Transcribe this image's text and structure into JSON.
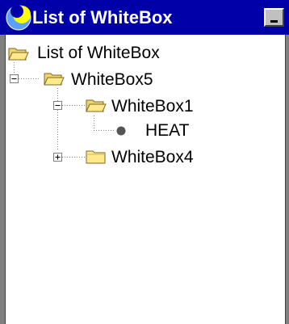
{
  "window": {
    "title": "List of WhiteBox",
    "minimize_icon": "minimize-icon",
    "app_icon": "moon-icon"
  },
  "tree": {
    "root": {
      "label": "List of WhiteBox",
      "icon": "folder-open-icon"
    },
    "nodes": [
      {
        "label": "WhiteBox5",
        "icon": "folder-open-icon",
        "expanded": true
      },
      {
        "label": "WhiteBox1",
        "icon": "folder-open-icon",
        "expanded": true
      },
      {
        "label": "HEAT",
        "icon": "leaf-dot-icon"
      },
      {
        "label": "WhiteBox4",
        "icon": "folder-closed-icon",
        "expanded": false
      }
    ]
  },
  "colors": {
    "titlebar": "#0000a8",
    "folder_fill": "#ffe98a",
    "folder_tab": "#f3d36a"
  }
}
